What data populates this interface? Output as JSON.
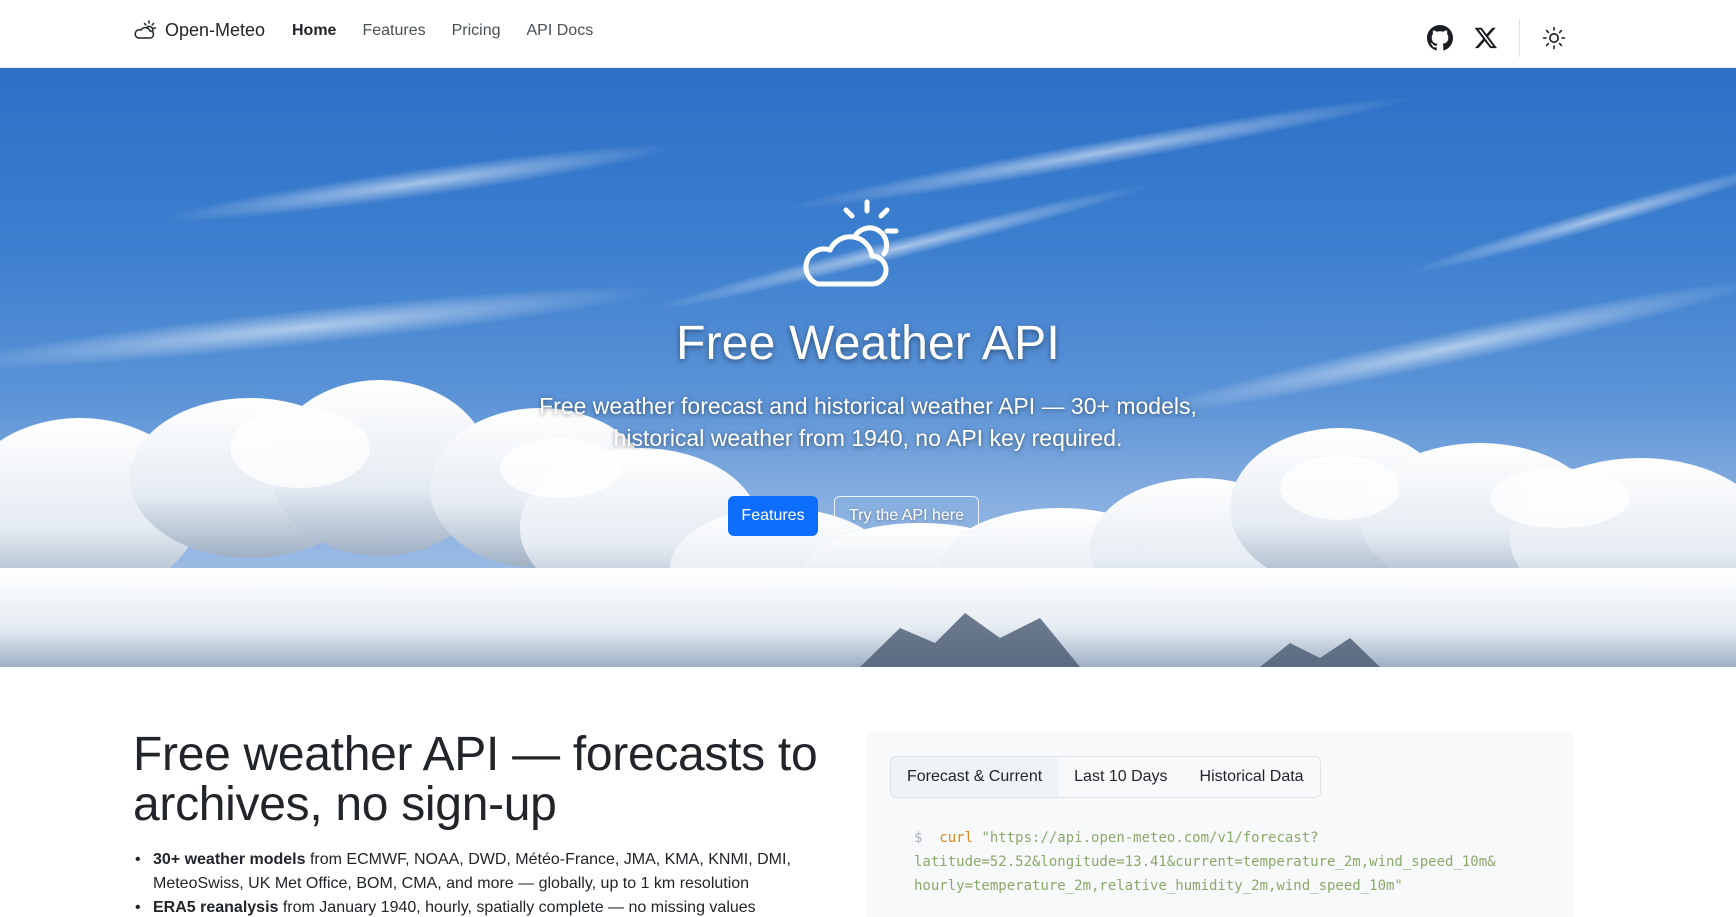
{
  "nav": {
    "brand": "Open-Meteo",
    "links": [
      {
        "label": "Home",
        "active": true
      },
      {
        "label": "Features",
        "active": false
      },
      {
        "label": "Pricing",
        "active": false
      },
      {
        "label": "API Docs",
        "active": false
      }
    ],
    "icons": [
      "github-icon",
      "x-twitter-icon",
      "sun-theme-icon"
    ]
  },
  "hero": {
    "title": "Free Weather API",
    "subtitle_line1": "Free weather forecast and historical weather API — 30+ models,",
    "subtitle_line2": "historical weather from 1940, no API key required.",
    "primary_button": "Features",
    "secondary_button": "Try the API here"
  },
  "lead": {
    "title_line1": "Free weather API — forecasts to",
    "title_line2": "archives, no sign-up",
    "bullets": [
      {
        "bold": "30+ weather models",
        "text": " from ECMWF, NOAA, DWD, Météo-France, JMA, KMA, KNMI, DMI, MeteoSwiss, UK Met Office, BOM, CMA, and more — globally, up to 1 km resolution"
      },
      {
        "bold": "ERA5 reanalysis",
        "text": " from January 1940, hourly, spatially complete — no missing values"
      }
    ]
  },
  "code_panel": {
    "tabs": [
      "Forecast & Current",
      "Last 10 Days",
      "Historical Data"
    ],
    "active_tab": "Forecast & Current",
    "prompt": "$",
    "command": "curl",
    "line1": "\"https://api.open-meteo.com/v1/forecast?",
    "line2": "latitude=52.52&longitude=13.41&current=temperature_2m,wind_speed_10m&",
    "line3": "hourly=temperature_2m,relative_humidity_2m,wind_speed_10m\""
  },
  "colors": {
    "primary": "#0d6efd",
    "sky_top": "#2c6fc6",
    "code_text": "#8aa86a",
    "code_command": "#d4891a"
  }
}
